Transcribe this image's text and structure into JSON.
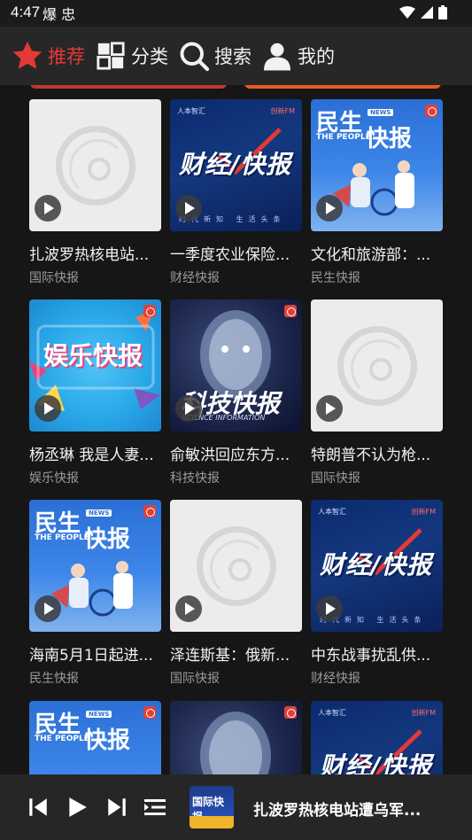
{
  "status_bar": {
    "time": "4:47",
    "notif_icons": "爆 忠"
  },
  "nav": {
    "items": [
      {
        "label": "推荐",
        "icon": "star-icon",
        "active": true
      },
      {
        "label": "分类",
        "icon": "grid-icon",
        "active": false
      },
      {
        "label": "搜索",
        "icon": "search-icon",
        "active": false
      },
      {
        "label": "我的",
        "icon": "user-icon",
        "active": false
      }
    ]
  },
  "colors": {
    "accent": "#e53935",
    "background": "#161616",
    "nav_bg": "#272727"
  },
  "cards": [
    {
      "title": "扎波罗热核电站...",
      "category": "国际快报",
      "thumb": "placeholder"
    },
    {
      "title": "一季度农业保险...",
      "category": "财经快报",
      "thumb": "caijing"
    },
    {
      "title": "文化和旅游部：...",
      "category": "民生快报",
      "thumb": "minsheng"
    },
    {
      "title": "杨丞琳 我是人妻...",
      "category": "娱乐快报",
      "thumb": "yule"
    },
    {
      "title": "俞敏洪回应东方...",
      "category": "科技快报",
      "thumb": "keji"
    },
    {
      "title": "特朗普不认为枪...",
      "category": "国际快报",
      "thumb": "placeholder"
    },
    {
      "title": "海南5月1日起进...",
      "category": "民生快报",
      "thumb": "minsheng"
    },
    {
      "title": "泽连斯基：俄新...",
      "category": "国际快报",
      "thumb": "placeholder"
    },
    {
      "title": "中东战事扰乱供...",
      "category": "财经快报",
      "thumb": "caijing"
    },
    {
      "title": "",
      "category": "",
      "thumb": "minsheng"
    },
    {
      "title": "",
      "category": "",
      "thumb": "keji"
    },
    {
      "title": "",
      "category": "",
      "thumb": "caijing"
    }
  ],
  "thumb_text": {
    "caijing": {
      "big": "财经/快报",
      "brand": "人本智汇",
      "brand2": "创新FM",
      "foot": "时代新知 生活头条"
    },
    "minsheng": {
      "a": "民生",
      "b": "THE PEOPLE",
      "c": "快报",
      "news": "NEWS"
    },
    "yule": {
      "big": "娱乐快报"
    },
    "keji": {
      "big": "科技快报",
      "sub": "SCIENCE INFORMATION"
    }
  },
  "player": {
    "now_playing": "扎波罗热核电站遭乌军...",
    "cover_text": "国际快报",
    "controls": [
      "skip-previous-icon",
      "play-icon",
      "skip-next-icon",
      "playlist-icon"
    ]
  }
}
